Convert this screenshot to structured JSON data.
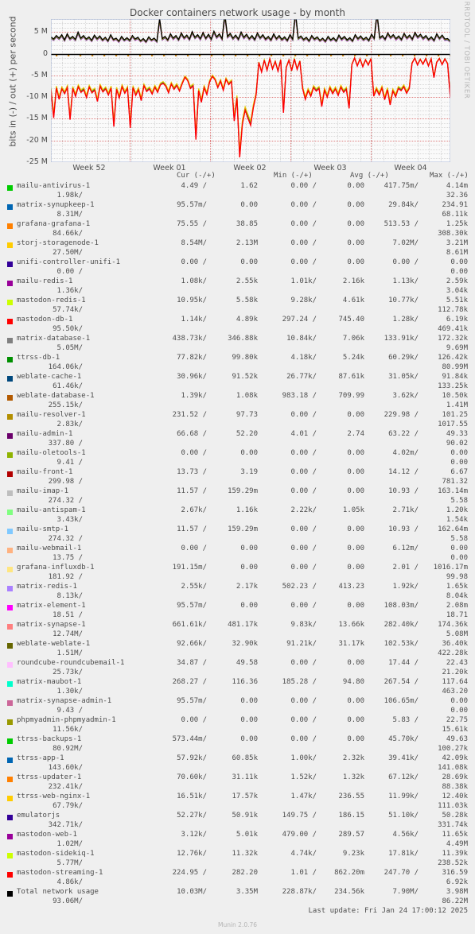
{
  "graph": {
    "title": "Docker containers network usage - by month",
    "y_axis_label": "bits in (-) / out (+) per second",
    "watermark": "RRDTOOL / TOBI OETIKER",
    "y_ticks": [
      "5 M",
      "0",
      "-5 M",
      "-10 M",
      "-15 M",
      "-20 M",
      "-25 M"
    ],
    "x_ticks": [
      "Week 52",
      "Week 01",
      "Week 02",
      "Week 03",
      "Week 04"
    ]
  },
  "legend": {
    "headers": [
      "Cur (-/+)",
      "Min (-/+)",
      "Avg (-/+)",
      "Max (-/+)"
    ],
    "rows": [
      {
        "label": "mailu-antivirus-1",
        "color": "#00cc00",
        "cur_neg": "4.49 /",
        "cur_pos": "1.62",
        "min_neg": "0.00 /",
        "min_pos": "0.00",
        "avg_neg": "417.75m/",
        "avg_pos": "4.14m",
        "max_neg": "1.98k/",
        "max_pos": "32.36"
      },
      {
        "label": "matrix-synupkeep-1",
        "color": "#0066b3",
        "cur_neg": "95.57m/",
        "cur_pos": "0.00",
        "min_neg": "0.00 /",
        "min_pos": "0.00",
        "avg_neg": "29.84k/",
        "avg_pos": "234.91",
        "max_neg": "8.31M/",
        "max_pos": "68.11k"
      },
      {
        "label": "grafana-grafana-1",
        "color": "#ff8000",
        "cur_neg": "75.55 /",
        "cur_pos": "38.85",
        "min_neg": "0.00 /",
        "min_pos": "0.00",
        "avg_neg": "513.53 /",
        "avg_pos": "1.25k",
        "max_neg": "84.66k/",
        "max_pos": "308.30k"
      },
      {
        "label": "storj-storagenode-1",
        "color": "#ffcc00",
        "cur_neg": "8.54M/",
        "cur_pos": "2.13M",
        "min_neg": "0.00 /",
        "min_pos": "0.00",
        "avg_neg": "7.02M/",
        "avg_pos": "3.21M",
        "max_neg": "27.50M/",
        "max_pos": "8.61M"
      },
      {
        "label": "unifi-controller-unifi-1",
        "color": "#330099",
        "cur_neg": "0.00 /",
        "cur_pos": "0.00",
        "min_neg": "0.00 /",
        "min_pos": "0.00",
        "avg_neg": "0.00 /",
        "avg_pos": "0.00",
        "max_neg": "0.00 /",
        "max_pos": "0.00"
      },
      {
        "label": "mailu-redis-1",
        "color": "#990099",
        "cur_neg": "1.08k/",
        "cur_pos": "2.55k",
        "min_neg": "1.01k/",
        "min_pos": "2.16k",
        "avg_neg": "1.13k/",
        "avg_pos": "2.59k",
        "max_neg": "1.36k/",
        "max_pos": "3.04k"
      },
      {
        "label": "mastodon-redis-1",
        "color": "#ccff00",
        "cur_neg": "10.95k/",
        "cur_pos": "5.58k",
        "min_neg": "9.28k/",
        "min_pos": "4.61k",
        "avg_neg": "10.77k/",
        "avg_pos": "5.51k",
        "max_neg": "57.74k/",
        "max_pos": "112.78k"
      },
      {
        "label": "mastodon-db-1",
        "color": "#ff0000",
        "cur_neg": "1.14k/",
        "cur_pos": "4.89k",
        "min_neg": "297.24 /",
        "min_pos": "745.40",
        "avg_neg": "1.28k/",
        "avg_pos": "6.19k",
        "max_neg": "95.50k/",
        "max_pos": "469.41k"
      },
      {
        "label": "matrix-database-1",
        "color": "#808080",
        "cur_neg": "438.73k/",
        "cur_pos": "346.88k",
        "min_neg": "10.84k/",
        "min_pos": "7.06k",
        "avg_neg": "133.91k/",
        "avg_pos": "172.32k",
        "max_neg": "5.05M/",
        "max_pos": "9.69M"
      },
      {
        "label": "ttrss-db-1",
        "color": "#008f00",
        "cur_neg": "77.82k/",
        "cur_pos": "99.80k",
        "min_neg": "4.18k/",
        "min_pos": "5.24k",
        "avg_neg": "60.29k/",
        "avg_pos": "126.42k",
        "max_neg": "164.06k/",
        "max_pos": "80.99M"
      },
      {
        "label": "weblate-cache-1",
        "color": "#00487d",
        "cur_neg": "30.96k/",
        "cur_pos": "91.52k",
        "min_neg": "26.77k/",
        "min_pos": "87.61k",
        "avg_neg": "31.05k/",
        "avg_pos": "91.84k",
        "max_neg": "61.46k/",
        "max_pos": "133.25k"
      },
      {
        "label": "weblate-database-1",
        "color": "#b35a00",
        "cur_neg": "1.39k/",
        "cur_pos": "1.08k",
        "min_neg": "983.18 /",
        "min_pos": "709.99",
        "avg_neg": "3.62k/",
        "avg_pos": "10.50k",
        "max_neg": "255.15k/",
        "max_pos": "1.41M"
      },
      {
        "label": "mailu-resolver-1",
        "color": "#b38f00",
        "cur_neg": "231.52 /",
        "cur_pos": "97.73",
        "min_neg": "0.00 /",
        "min_pos": "0.00",
        "avg_neg": "229.98 /",
        "avg_pos": "101.25",
        "max_neg": "2.83k/",
        "max_pos": "1017.55"
      },
      {
        "label": "mailu-admin-1",
        "color": "#6b006b",
        "cur_neg": "66.68 /",
        "cur_pos": "52.20",
        "min_neg": "4.01 /",
        "min_pos": "2.74",
        "avg_neg": "63.22 /",
        "avg_pos": "49.33",
        "max_neg": "337.80 /",
        "max_pos": "90.02"
      },
      {
        "label": "mailu-oletools-1",
        "color": "#8fb300",
        "cur_neg": "0.00 /",
        "cur_pos": "0.00",
        "min_neg": "0.00 /",
        "min_pos": "0.00",
        "avg_neg": "4.02m/",
        "avg_pos": "0.00",
        "max_neg": "9.41 /",
        "max_pos": "0.00"
      },
      {
        "label": "mailu-front-1",
        "color": "#b30000",
        "cur_neg": "13.73 /",
        "cur_pos": "3.19",
        "min_neg": "0.00 /",
        "min_pos": "0.00",
        "avg_neg": "14.12 /",
        "avg_pos": "6.67",
        "max_neg": "299.98 /",
        "max_pos": "781.32"
      },
      {
        "label": "mailu-imap-1",
        "color": "#bebebe",
        "cur_neg": "11.57 /",
        "cur_pos": "159.29m",
        "min_neg": "0.00 /",
        "min_pos": "0.00",
        "avg_neg": "10.93 /",
        "avg_pos": "163.14m",
        "max_neg": "274.32 /",
        "max_pos": "5.58"
      },
      {
        "label": "mailu-antispam-1",
        "color": "#80ff80",
        "cur_neg": "2.67k/",
        "cur_pos": "1.16k",
        "min_neg": "2.22k/",
        "min_pos": "1.05k",
        "avg_neg": "2.71k/",
        "avg_pos": "1.20k",
        "max_neg": "3.43k/",
        "max_pos": "1.54k"
      },
      {
        "label": "mailu-smtp-1",
        "color": "#80c9ff",
        "cur_neg": "11.57 /",
        "cur_pos": "159.29m",
        "min_neg": "0.00 /",
        "min_pos": "0.00",
        "avg_neg": "10.93 /",
        "avg_pos": "162.64m",
        "max_neg": "274.32 /",
        "max_pos": "5.58"
      },
      {
        "label": "mailu-webmail-1",
        "color": "#ffb280",
        "cur_neg": "0.00 /",
        "cur_pos": "0.00",
        "min_neg": "0.00 /",
        "min_pos": "0.00",
        "avg_neg": "6.12m/",
        "avg_pos": "0.00",
        "max_neg": "13.75 /",
        "max_pos": "0.00"
      },
      {
        "label": "grafana-influxdb-1",
        "color": "#ffe680",
        "cur_neg": "191.15m/",
        "cur_pos": "0.00",
        "min_neg": "0.00 /",
        "min_pos": "0.00",
        "avg_neg": "2.01 /",
        "avg_pos": "1016.17m",
        "max_neg": "181.92 /",
        "max_pos": "99.98"
      },
      {
        "label": "matrix-redis-1",
        "color": "#aa80ff",
        "cur_neg": "2.55k/",
        "cur_pos": "2.17k",
        "min_neg": "502.23 /",
        "min_pos": "413.23",
        "avg_neg": "1.92k/",
        "avg_pos": "1.65k",
        "max_neg": "8.13k/",
        "max_pos": "8.04k"
      },
      {
        "label": "matrix-element-1",
        "color": "#ff00ff",
        "cur_neg": "95.57m/",
        "cur_pos": "0.00",
        "min_neg": "0.00 /",
        "min_pos": "0.00",
        "avg_neg": "108.03m/",
        "avg_pos": "2.08m",
        "max_neg": "18.51 /",
        "max_pos": "18.71"
      },
      {
        "label": "matrix-synapse-1",
        "color": "#ff7f7f",
        "cur_neg": "661.61k/",
        "cur_pos": "481.17k",
        "min_neg": "9.83k/",
        "min_pos": "13.66k",
        "avg_neg": "282.40k/",
        "avg_pos": "174.36k",
        "max_neg": "12.74M/",
        "max_pos": "5.08M"
      },
      {
        "label": "weblate-weblate-1",
        "color": "#666600",
        "cur_neg": "92.66k/",
        "cur_pos": "32.90k",
        "min_neg": "91.21k/",
        "min_pos": "31.17k",
        "avg_neg": "102.53k/",
        "avg_pos": "36.40k",
        "max_neg": "1.51M/",
        "max_pos": "422.28k"
      },
      {
        "label": "roundcube-roundcubemail-1",
        "color": "#ffbfff",
        "cur_neg": "34.87 /",
        "cur_pos": "49.58",
        "min_neg": "0.00 /",
        "min_pos": "0.00",
        "avg_neg": "17.44 /",
        "avg_pos": "22.43",
        "max_neg": "25.73k/",
        "max_pos": "21.20k"
      },
      {
        "label": "matrix-maubot-1",
        "color": "#00ffcc",
        "cur_neg": "268.27 /",
        "cur_pos": "116.36",
        "min_neg": "185.28 /",
        "min_pos": "94.80",
        "avg_neg": "267.54 /",
        "avg_pos": "117.64",
        "max_neg": "1.30k/",
        "max_pos": "463.20"
      },
      {
        "label": "matrix-synapse-admin-1",
        "color": "#cc6699",
        "cur_neg": "95.57m/",
        "cur_pos": "0.00",
        "min_neg": "0.00 /",
        "min_pos": "0.00",
        "avg_neg": "106.65m/",
        "avg_pos": "0.00",
        "max_neg": "9.43 /",
        "max_pos": "0.00"
      },
      {
        "label": "phpmyadmin-phpmyadmin-1",
        "color": "#999900",
        "cur_neg": "0.00 /",
        "cur_pos": "0.00",
        "min_neg": "0.00 /",
        "min_pos": "0.00",
        "avg_neg": "5.83 /",
        "avg_pos": "22.75",
        "max_neg": "11.56k/",
        "max_pos": "15.61k"
      },
      {
        "label": "ttrss-backups-1",
        "color": "#00cc00",
        "cur_neg": "573.44m/",
        "cur_pos": "0.00",
        "min_neg": "0.00 /",
        "min_pos": "0.00",
        "avg_neg": "45.70k/",
        "avg_pos": "49.63",
        "max_neg": "80.92M/",
        "max_pos": "100.27k"
      },
      {
        "label": "ttrss-app-1",
        "color": "#0066b3",
        "cur_neg": "57.92k/",
        "cur_pos": "60.85k",
        "min_neg": "1.00k/",
        "min_pos": "2.32k",
        "avg_neg": "39.41k/",
        "avg_pos": "42.09k",
        "max_neg": "143.60k/",
        "max_pos": "141.08k"
      },
      {
        "label": "ttrss-updater-1",
        "color": "#ff8000",
        "cur_neg": "70.60k/",
        "cur_pos": "31.11k",
        "min_neg": "1.52k/",
        "min_pos": "1.32k",
        "avg_neg": "67.12k/",
        "avg_pos": "28.69k",
        "max_neg": "232.41k/",
        "max_pos": "88.38k"
      },
      {
        "label": "ttrss-web-nginx-1",
        "color": "#ffcc00",
        "cur_neg": "16.51k/",
        "cur_pos": "17.57k",
        "min_neg": "1.47k/",
        "min_pos": "236.55",
        "avg_neg": "11.99k/",
        "avg_pos": "12.40k",
        "max_neg": "67.79k/",
        "max_pos": "111.03k"
      },
      {
        "label": "emulatorjs",
        "color": "#330099",
        "cur_neg": "52.27k/",
        "cur_pos": "50.91k",
        "min_neg": "149.75 /",
        "min_pos": "186.15",
        "avg_neg": "51.10k/",
        "avg_pos": "50.28k",
        "max_neg": "342.71k/",
        "max_pos": "331.74k"
      },
      {
        "label": "mastodon-web-1",
        "color": "#990099",
        "cur_neg": "3.12k/",
        "cur_pos": "5.01k",
        "min_neg": "479.00 /",
        "min_pos": "289.57",
        "avg_neg": "4.56k/",
        "avg_pos": "11.65k",
        "max_neg": "1.02M/",
        "max_pos": "4.49M"
      },
      {
        "label": "mastodon-sidekiq-1",
        "color": "#ccff00",
        "cur_neg": "12.76k/",
        "cur_pos": "11.32k",
        "min_neg": "4.74k/",
        "min_pos": "9.23k",
        "avg_neg": "17.81k/",
        "avg_pos": "11.39k",
        "max_neg": "5.77M/",
        "max_pos": "238.52k"
      },
      {
        "label": "mastodon-streaming-1",
        "color": "#ff0000",
        "cur_neg": "224.95 /",
        "cur_pos": "282.20",
        "min_neg": "1.01 /",
        "min_pos": "862.20m",
        "avg_neg": "247.70 /",
        "avg_pos": "316.59",
        "max_neg": "4.86k/",
        "max_pos": "6.92k"
      },
      {
        "label": "Total network usage",
        "color": "#000000",
        "cur_neg": "10.03M/",
        "cur_pos": "3.35M",
        "min_neg": "228.87k/",
        "min_pos": "234.56k",
        "avg_neg": "7.90M/",
        "avg_pos": "3.98M",
        "max_neg": "93.06M/",
        "max_pos": "86.22M"
      }
    ]
  },
  "footer": {
    "last_update": "Last update: Fri Jan 24 17:00:12 2025",
    "munin_version": "Munin 2.0.76"
  },
  "chart_data": {
    "type": "area",
    "title": "Docker containers network usage - by month",
    "xlabel": "",
    "ylabel": "bits in (-) / out (+) per second",
    "ylim": [
      -25000000,
      8000000
    ],
    "ytick_values": [
      5000000,
      0,
      -5000000,
      -10000000,
      -15000000,
      -20000000,
      -25000000
    ],
    "ytick_labels": [
      "5 M",
      "0",
      "-5 M",
      "-10 M",
      "-15 M",
      "-20 M",
      "-25 M"
    ],
    "xtick_labels": [
      "Week 52",
      "Week 01",
      "Week 02",
      "Week 03",
      "Week 04"
    ],
    "grid": true,
    "legend_position": "below",
    "series": [
      {
        "name": "Total network usage out (+)",
        "color": "#000000",
        "values": [
          3.9,
          3.4,
          4.2,
          3.6,
          4.4,
          3.2,
          4.6,
          3.5,
          4.0,
          3.3,
          5.0,
          3.6,
          4.2,
          3.4,
          3.9,
          3.1,
          4.3,
          3.5,
          4.1,
          3.2,
          3.8,
          3.0,
          4.4,
          3.3,
          3.6,
          2.9,
          4.0,
          3.2,
          3.7,
          3.1,
          4.2,
          3.4,
          3.8,
          3.0,
          3.5,
          2.8,
          3.9,
          3.2,
          3.6,
          2.9,
          8.1,
          3.5,
          4.0,
          3.2,
          4.6,
          3.6,
          4.2,
          3.3,
          4.8,
          3.7,
          4.3,
          3.4,
          5.1,
          3.8,
          4.4,
          3.5,
          4.9,
          3.6,
          4.5,
          3.4,
          5.2,
          3.9,
          4.6,
          3.5,
          9.2,
          4.0,
          4.7,
          3.6,
          4.3,
          3.4,
          5.0,
          3.8,
          4.5,
          3.5,
          4.2,
          3.3,
          4.8,
          3.7,
          4.4,
          3.4,
          4.0,
          3.2,
          4.6,
          3.5,
          4.2,
          3.3,
          3.9,
          3.1,
          4.4,
          3.4,
          9.7,
          3.6,
          4.1,
          3.3,
          3.8,
          3.0,
          4.2,
          3.4,
          3.9,
          3.1,
          3.6,
          2.9,
          4.0,
          3.2,
          3.7,
          3.0,
          4.3,
          3.4,
          4.0,
          3.2,
          3.7,
          3.0,
          4.4,
          3.5,
          4.1,
          3.3,
          3.8,
          3.1,
          4.5,
          3.6,
          9.5,
          3.7,
          4.2,
          3.4,
          4.8,
          3.8,
          4.4,
          3.5,
          4.1,
          3.3,
          4.7,
          3.7,
          4.3,
          3.4,
          4.9,
          3.9,
          4.5,
          3.6,
          4.2,
          3.3,
          3.9,
          3.1,
          4.6,
          3.6,
          4.3,
          3.4,
          3.5,
          2.9
        ]
      },
      {
        "name": "Total network usage in (-)",
        "color": "#ff0000",
        "values": [
          -8.2,
          -14.8,
          -7.9,
          -10.5,
          -8.1,
          -9.2,
          -7.8,
          -15.2,
          -8.0,
          -9.8,
          -7.6,
          -8.9,
          -8.3,
          -10.1,
          -7.7,
          -9.0,
          -8.4,
          -11.0,
          -7.5,
          -8.8,
          -8.1,
          -9.5,
          -7.9,
          -16.8,
          -8.2,
          -10.2,
          -7.6,
          -9.1,
          -8.0,
          -17.1,
          -7.8,
          -9.6,
          -8.3,
          -10.8,
          -7.4,
          -8.7,
          -8.1,
          -9.3,
          -7.7,
          -8.9,
          -7.2,
          -6.8,
          -7.5,
          -9.0,
          -7.0,
          -8.2,
          -7.3,
          -8.6,
          -6.9,
          -5.4,
          -6.2,
          -8.0,
          -7.4,
          -19.8,
          -8.5,
          -11.2,
          -7.8,
          -9.4,
          -6.5,
          -5.2,
          -6.0,
          -7.8,
          -6.3,
          -8.4,
          -5.9,
          -7.1,
          -6.4,
          -15.5,
          -10.2,
          -23.9,
          -16.2,
          -13.0,
          -14.8,
          -16.5,
          -12.4,
          -9.5,
          -2.0,
          -4.2,
          -1.5,
          -3.8,
          -1.2,
          -3.5,
          -1.8,
          -4.0,
          -1.4,
          -13.6,
          -3.2,
          -1.5,
          -3.9,
          -1.2,
          -3.6,
          -1.7,
          -8.0,
          -10.5,
          -8.5,
          -9.8,
          -7.8,
          -8.6,
          -8.0,
          -12.2,
          -8.4,
          -10.0,
          -7.9,
          -9.2,
          -8.1,
          -9.6,
          -7.7,
          -8.9,
          -8.2,
          -12.6,
          -2.5,
          -1.0,
          -2.8,
          -1.2,
          -3.0,
          -1.4,
          -2.6,
          -1.1,
          -9.8,
          -8.2,
          -9.5,
          -7.9,
          -10.6,
          -8.3,
          -11.8,
          -8.6,
          -9.9,
          -8.0,
          -8.5,
          -7.6,
          -9.1,
          -8.0,
          -2.2,
          -1.0,
          -2.6,
          -1.3,
          -2.4,
          -1.1,
          -2.8,
          -1.2,
          -5.5,
          -2.0,
          -1.1,
          -2.5,
          -1.2,
          -2.3,
          -10.2
        ]
      }
    ]
  }
}
